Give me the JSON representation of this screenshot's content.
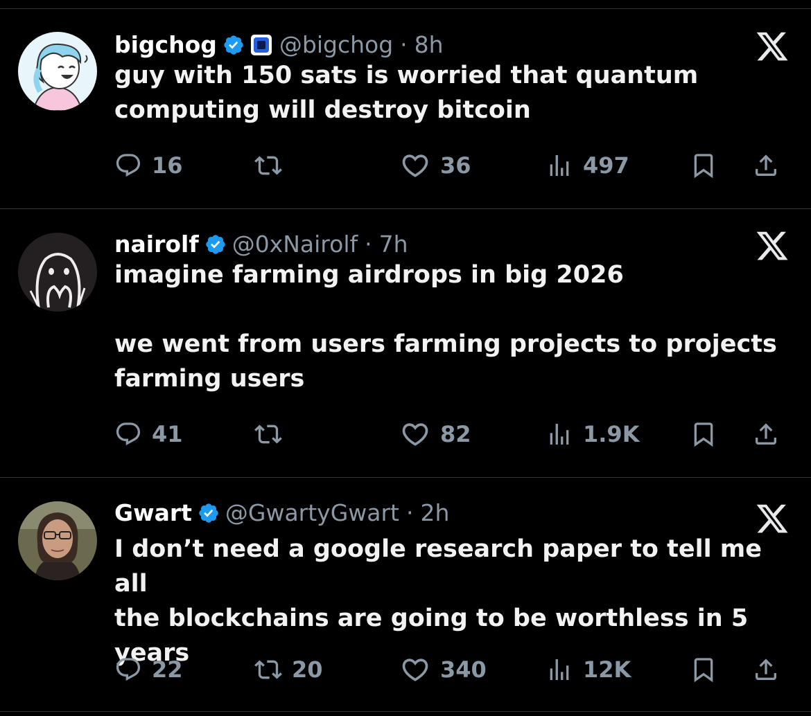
{
  "tweets": [
    {
      "name": "bigchog",
      "handle": "@bigchog",
      "time": "8h",
      "text": "guy with 150 sats is worried that quantum\ncomputing will destroy bitcoin",
      "replies": "16",
      "reposts": "",
      "likes": "36",
      "views": "497",
      "has_affiliate_badge": true
    },
    {
      "name": "nairolf",
      "handle": "@0xNairolf",
      "time": "7h",
      "text": "imagine farming airdrops in big 2026\n\nwe went from users farming projects to projects\nfarming users",
      "replies": "41",
      "reposts": "",
      "likes": "82",
      "views": "1.9K",
      "has_affiliate_badge": false
    },
    {
      "name": "Gwart",
      "handle": "@GwartyGwart",
      "time": "2h",
      "text": "I don’t need a google research paper to tell me all\nthe blockchains are going to be worthless in 5\nyears",
      "replies": "22",
      "reposts": "20",
      "likes": "340",
      "views": "12K",
      "has_affiliate_badge": false
    }
  ],
  "separator": "·",
  "icons": {
    "reply": "reply-icon",
    "repost": "repost-icon",
    "like": "heart-icon",
    "views": "views-icon",
    "bookmark": "bookmark-icon",
    "share": "share-icon",
    "verified": "verified-badge-icon",
    "x_logo": "x-logo-icon"
  },
  "colors": {
    "background": "#000000",
    "text": "#e7e9ea",
    "muted": "#8b98a5",
    "verified": "#1d9bf0",
    "divider": "#2f3336"
  }
}
